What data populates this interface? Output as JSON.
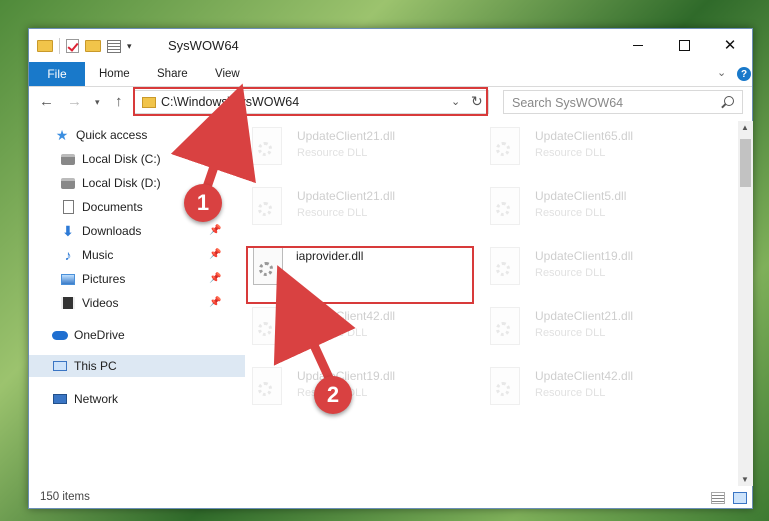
{
  "window": {
    "title": "SysWOW64",
    "qat_dropdown": "▾"
  },
  "ribbon": {
    "tabs": [
      "File",
      "Home",
      "Share",
      "View"
    ],
    "help": "?"
  },
  "nav": {
    "back": "←",
    "forward": "→",
    "recent": "▾",
    "up": "↑",
    "address": "C:\\Windows\\SysWOW64",
    "address_dropdown": "⌄",
    "refresh": "↻",
    "search_placeholder": "Search SysWOW64"
  },
  "sidebar": {
    "items": [
      {
        "label": "Quick access",
        "icon": "star-icon"
      },
      {
        "label": "Local Disk (C:)",
        "icon": "disk-icon"
      },
      {
        "label": "Local Disk (D:)",
        "icon": "disk-icon"
      },
      {
        "label": "Documents",
        "icon": "document-icon"
      },
      {
        "label": "Downloads",
        "icon": "download-icon",
        "pinned": true
      },
      {
        "label": "Music",
        "icon": "music-icon",
        "pinned": true
      },
      {
        "label": "Pictures",
        "icon": "pictures-icon",
        "pinned": true
      },
      {
        "label": "Videos",
        "icon": "videos-icon",
        "pinned": true
      },
      {
        "label": "OneDrive",
        "icon": "cloud-icon"
      },
      {
        "label": "This PC",
        "icon": "computer-icon",
        "selected": true
      },
      {
        "label": "Network",
        "icon": "network-icon"
      }
    ],
    "pin_glyph": "📌"
  },
  "files": {
    "left_column": [
      {
        "name": "UpdateClient21.dll",
        "type": "Resource DLL"
      },
      {
        "name": "UpdateClient21.dll",
        "type": "Resource DLL"
      },
      {
        "name": "iaprovider.dll",
        "type": ""
      },
      {
        "name": "UpdateClient42.dll",
        "type": "Resource DLL"
      },
      {
        "name": "UpdateClient19.dll",
        "type": "Resource DLL"
      }
    ],
    "right_column": [
      {
        "name": "UpdateClient65.dll",
        "type": "Resource DLL"
      },
      {
        "name": "UpdateClient5.dll",
        "type": "Resource DLL"
      },
      {
        "name": "UpdateClient19.dll",
        "type": "Resource DLL"
      },
      {
        "name": "UpdateClient21.dll",
        "type": "Resource DLL"
      },
      {
        "name": "UpdateClient42.dll",
        "type": "Resource DLL"
      }
    ]
  },
  "status": {
    "item_count": "150 items"
  },
  "annotations": {
    "step1": "1",
    "step2": "2",
    "color": "#d94141"
  },
  "colors": {
    "accent": "#1979ca",
    "highlight": "#d83a3a",
    "selected_bg": "#dde8f3"
  }
}
